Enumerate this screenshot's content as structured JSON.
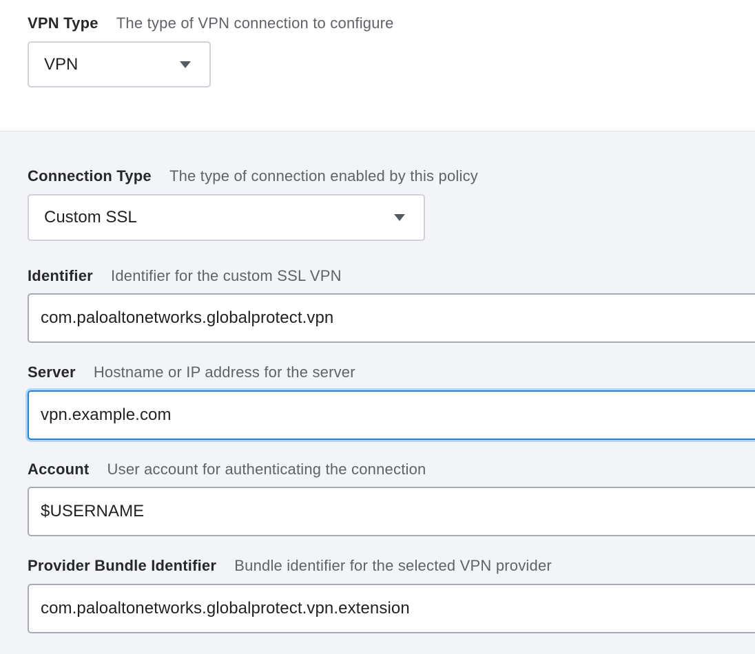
{
  "vpn_type": {
    "label": "VPN Type",
    "description": "The type of VPN connection to configure",
    "selected": "VPN"
  },
  "connection_type": {
    "label": "Connection Type",
    "description": "The type of connection enabled by this policy",
    "selected": "Custom SSL"
  },
  "identifier": {
    "label": "Identifier",
    "description": "Identifier for the custom SSL VPN",
    "value": "com.paloaltonetworks.globalprotect.vpn"
  },
  "server": {
    "label": "Server",
    "description": "Hostname or IP address for the server",
    "value": "vpn.example.com"
  },
  "account": {
    "label": "Account",
    "description": "User account for authenticating the connection",
    "value": "$USERNAME"
  },
  "provider_bundle": {
    "label": "Provider Bundle Identifier",
    "description": "Bundle identifier for the selected VPN provider",
    "value": "com.paloaltonetworks.globalprotect.vpn.extension"
  },
  "colors": {
    "focus_ring": "#1c82e8",
    "panel_background": "#f3f4f7",
    "top_background": "#ffffff"
  },
  "icons": {
    "dropdown": "chevron-down-icon"
  }
}
